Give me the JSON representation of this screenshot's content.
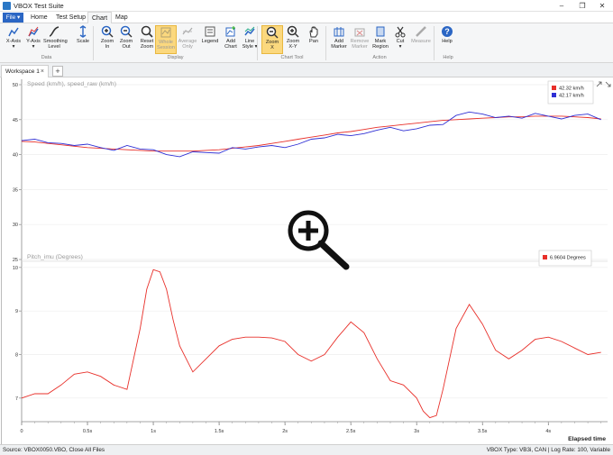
{
  "window": {
    "title": "VBOX Test Suite"
  },
  "menubar": {
    "file": "File ▾",
    "tabs": [
      "Home",
      "Test Setup",
      "Chart",
      "Map"
    ],
    "active_tab": "Chart"
  },
  "ribbon": {
    "buttons": [
      {
        "label": "X-Axis\n▾",
        "icon": "x-axis-icon",
        "state": "normal"
      },
      {
        "label": "Y-Axis\n▾",
        "icon": "y-axis-icon",
        "state": "normal"
      },
      {
        "label": "Smoothing\nLevel",
        "icon": "smoothing-icon",
        "state": "normal"
      },
      {
        "label": "Scale",
        "icon": "scale-icon",
        "state": "normal"
      },
      {
        "label": "Zoom\nIn",
        "icon": "zoom-in-icon",
        "state": "normal"
      },
      {
        "label": "Zoom\nOut",
        "icon": "zoom-out-icon",
        "state": "normal"
      },
      {
        "label": "Reset\nZoom",
        "icon": "reset-zoom-icon",
        "state": "normal"
      },
      {
        "label": "Whole\nSession",
        "icon": "whole-session-icon",
        "state": "selected-disabled"
      },
      {
        "label": "Average\nOnly",
        "icon": "average-only-icon",
        "state": "disabled"
      },
      {
        "label": "Legend",
        "icon": "legend-icon",
        "state": "normal"
      },
      {
        "label": "Add\nChart",
        "icon": "add-chart-icon",
        "state": "normal"
      },
      {
        "label": "Line\nStyle ▾",
        "icon": "line-style-icon",
        "state": "normal"
      },
      {
        "label": "Zoom\nX",
        "icon": "zoom-x-icon",
        "state": "selected"
      },
      {
        "label": "Zoom\nX-Y",
        "icon": "zoom-xy-icon",
        "state": "normal"
      },
      {
        "label": "Pan",
        "icon": "pan-icon",
        "state": "normal"
      },
      {
        "label": "Add\nMarker",
        "icon": "add-marker-icon",
        "state": "normal"
      },
      {
        "label": "Remove\nMarker",
        "icon": "remove-marker-icon",
        "state": "disabled"
      },
      {
        "label": "Mark\nRegion",
        "icon": "mark-region-icon",
        "state": "normal"
      },
      {
        "label": "Cut\n▾",
        "icon": "cut-icon",
        "state": "normal"
      },
      {
        "label": "Measure",
        "icon": "measure-icon",
        "state": "disabled"
      },
      {
        "label": "Help",
        "icon": "help-icon",
        "state": "normal"
      }
    ],
    "groups": [
      "Data",
      "Display",
      "Chart Tool",
      "Action",
      "Help"
    ]
  },
  "workspace": {
    "tab_label": "Workspace 1",
    "close_glyph": "×",
    "add_glyph": "+"
  },
  "colors": {
    "accent": "#2b66c4",
    "series_red": "#e8302a",
    "series_blue": "#2f2fd4",
    "selected": "#fbd87e"
  },
  "chart_data": [
    {
      "type": "line",
      "title": "Speed (km/h), speed_raw (km/h)",
      "ylim": [
        25,
        50
      ],
      "yticks": [
        50,
        45,
        40,
        35,
        30,
        25
      ],
      "ytick_labels": [
        "50",
        "45",
        "40",
        "35",
        "30",
        "25"
      ],
      "x": [
        0,
        0.1,
        0.2,
        0.3,
        0.4,
        0.5,
        0.6,
        0.7,
        0.8,
        0.9,
        1.0,
        1.1,
        1.2,
        1.3,
        1.4,
        1.5,
        1.6,
        1.7,
        1.8,
        1.9,
        2.0,
        2.1,
        2.2,
        2.3,
        2.4,
        2.5,
        2.6,
        2.7,
        2.8,
        2.9,
        3.0,
        3.1,
        3.2,
        3.3,
        3.4,
        3.5,
        3.6,
        3.7,
        3.8,
        3.9,
        4.0,
        4.1,
        4.2,
        4.3,
        4.4
      ],
      "series": [
        {
          "name": "42.32 km/h",
          "color": "#e8302a",
          "values": [
            41.9,
            41.8,
            41.6,
            41.4,
            41.2,
            41.0,
            40.9,
            40.8,
            40.7,
            40.6,
            40.5,
            40.5,
            40.5,
            40.5,
            40.6,
            40.7,
            40.9,
            41.1,
            41.3,
            41.6,
            41.9,
            42.2,
            42.5,
            42.8,
            43.1,
            43.3,
            43.6,
            43.9,
            44.1,
            44.3,
            44.5,
            44.7,
            44.9,
            45.0,
            45.1,
            45.2,
            45.3,
            45.4,
            45.4,
            45.5,
            45.5,
            45.5,
            45.4,
            45.3,
            45.1
          ]
        },
        {
          "name": "42.17 km/h",
          "color": "#2f2fd4",
          "values": [
            42.0,
            42.2,
            41.7,
            41.6,
            41.3,
            41.5,
            41.0,
            40.6,
            41.3,
            40.8,
            40.7,
            40.0,
            39.7,
            40.4,
            40.3,
            40.2,
            41.0,
            40.8,
            41.1,
            41.3,
            41.0,
            41.5,
            42.2,
            42.4,
            42.9,
            42.7,
            43.0,
            43.5,
            43.9,
            43.4,
            43.7,
            44.2,
            44.3,
            45.6,
            46.1,
            45.8,
            45.3,
            45.5,
            45.2,
            45.9,
            45.5,
            45.1,
            45.6,
            45.8,
            45.0
          ]
        }
      ]
    },
    {
      "type": "line",
      "title": "Pitch_imu (Degrees)",
      "ylim": [
        6.5,
        10.1
      ],
      "yticks": [
        10,
        9,
        8,
        7
      ],
      "ytick_labels": [
        "10",
        "9",
        "8",
        "7"
      ],
      "xlabel": "Elapsed time",
      "xticks": [
        0,
        0.5,
        1,
        1.5,
        2,
        2.5,
        3,
        3.5,
        4
      ],
      "xtick_labels": [
        "0",
        "0.5s",
        "1s",
        "1.5s",
        "2s",
        "2.5s",
        "3s",
        "3.5s",
        "4s"
      ],
      "x": [
        0,
        0.1,
        0.2,
        0.3,
        0.4,
        0.5,
        0.6,
        0.7,
        0.8,
        0.9,
        0.95,
        1.0,
        1.05,
        1.1,
        1.15,
        1.2,
        1.3,
        1.4,
        1.5,
        1.6,
        1.7,
        1.8,
        1.9,
        2.0,
        2.1,
        2.2,
        2.3,
        2.4,
        2.5,
        2.6,
        2.7,
        2.8,
        2.9,
        3.0,
        3.05,
        3.1,
        3.15,
        3.2,
        3.3,
        3.4,
        3.5,
        3.6,
        3.7,
        3.8,
        3.9,
        4.0,
        4.1,
        4.2,
        4.3,
        4.4
      ],
      "series": [
        {
          "name": "6.9604 Degrees",
          "color": "#e8302a",
          "values": [
            7.0,
            7.1,
            7.1,
            7.3,
            7.55,
            7.6,
            7.5,
            7.3,
            7.2,
            8.6,
            9.5,
            9.95,
            9.9,
            9.5,
            8.8,
            8.2,
            7.6,
            7.9,
            8.2,
            8.35,
            8.4,
            8.4,
            8.38,
            8.3,
            8.0,
            7.85,
            8.0,
            8.4,
            8.75,
            8.5,
            7.9,
            7.4,
            7.3,
            7.0,
            6.7,
            6.55,
            6.6,
            7.2,
            8.6,
            9.15,
            8.7,
            8.1,
            7.9,
            8.1,
            8.35,
            8.4,
            8.3,
            8.15,
            8.0,
            8.05
          ]
        }
      ]
    }
  ],
  "statusbar": {
    "left": "Source: VBOX0050.VBO, Close All Files",
    "right": "VBOX Type: VB3i, CAN  |  Log Rate: 100, Variable"
  }
}
